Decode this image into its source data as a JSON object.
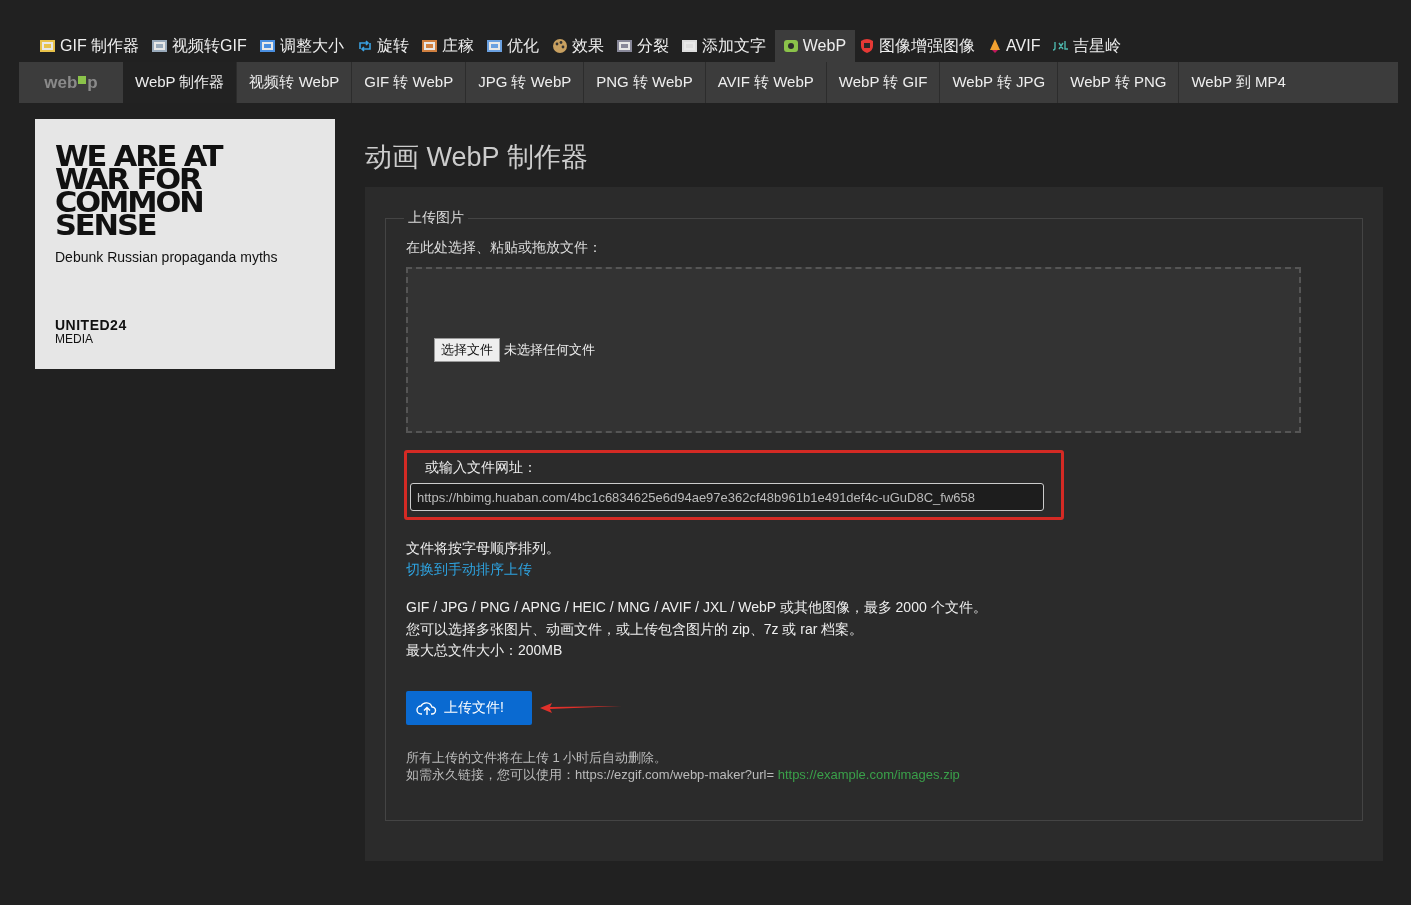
{
  "top_nav": [
    {
      "label": "GIF 制作器",
      "kind": "gif",
      "selected": false
    },
    {
      "label": "视频转GIF",
      "kind": "film",
      "selected": false
    },
    {
      "label": "调整大小",
      "kind": "resize",
      "selected": false
    },
    {
      "label": "旋转",
      "kind": "rotate",
      "selected": false
    },
    {
      "label": "庄稼",
      "kind": "crop",
      "selected": false
    },
    {
      "label": "优化",
      "kind": "optimize",
      "selected": false
    },
    {
      "label": "效果",
      "kind": "palette",
      "selected": false
    },
    {
      "label": "分裂",
      "kind": "split",
      "selected": false
    },
    {
      "label": "添加文字",
      "kind": "text",
      "selected": false
    },
    {
      "label": "WebP",
      "kind": "webp",
      "selected": true
    },
    {
      "label": "图像增强图像",
      "kind": "enhance",
      "selected": false
    },
    {
      "label": "AVIF",
      "kind": "avif",
      "selected": false
    },
    {
      "label": "吉星岭",
      "kind": "jxl",
      "selected": false
    }
  ],
  "sub_nav": {
    "logo_parts": [
      "web",
      "p"
    ],
    "items": [
      {
        "label": "WebP 制作器",
        "selected": true
      },
      {
        "label": "视频转 WebP",
        "selected": false
      },
      {
        "label": "GIF 转 WebP",
        "selected": false
      },
      {
        "label": "JPG 转 WebP",
        "selected": false
      },
      {
        "label": "PNG 转 WebP",
        "selected": false
      },
      {
        "label": "AVIF 转 WebP",
        "selected": false
      },
      {
        "label": "WebP 转 GIF",
        "selected": false
      },
      {
        "label": "WebP 转 JPG",
        "selected": false
      },
      {
        "label": "WebP 转 PNG",
        "selected": false
      },
      {
        "label": "WebP 到 MP4",
        "selected": false
      }
    ]
  },
  "ad": {
    "headline": [
      "WE ARE AT",
      "WAR FOR",
      "COMMON",
      "SENSE"
    ],
    "tagline": "Debunk Russian propaganda myths",
    "brand": "UNITED24",
    "brand_sub": "MEDIA"
  },
  "page_title": "动画 WebP 制作器",
  "upload": {
    "legend": "上传图片",
    "drop_label": "在此处选择、粘贴或拖放文件：",
    "file_button": "选择文件",
    "file_status": "未选择任何文件",
    "url_label": "或输入文件网址：",
    "url_value": "https://hbimg.huaban.com/4bc1c6834625e6d94ae97e362cf48b961b1e491def4c-uGuD8C_fw658",
    "order_note": "文件将按字母顺序排列。",
    "order_link": "切换到手动排序上传",
    "info_lines": [
      "GIF / JPG / PNG / APNG / HEIC / MNG / AVIF / JXL / WebP 或其他图像，最多 2000 个文件。",
      "您可以选择多张图片、动画文件，或上传包含图片的 zip、7z 或 rar 档案。",
      "最大总文件大小：200MB"
    ],
    "submit": "上传文件!",
    "footer_note": "所有上传的文件将在上传 1 小时后自动删除。",
    "footer_prefix": "如需永久链接，您可以使用：https://ezgif.com/webp-maker?url=",
    "footer_link": "https://example.com/images.zip"
  }
}
